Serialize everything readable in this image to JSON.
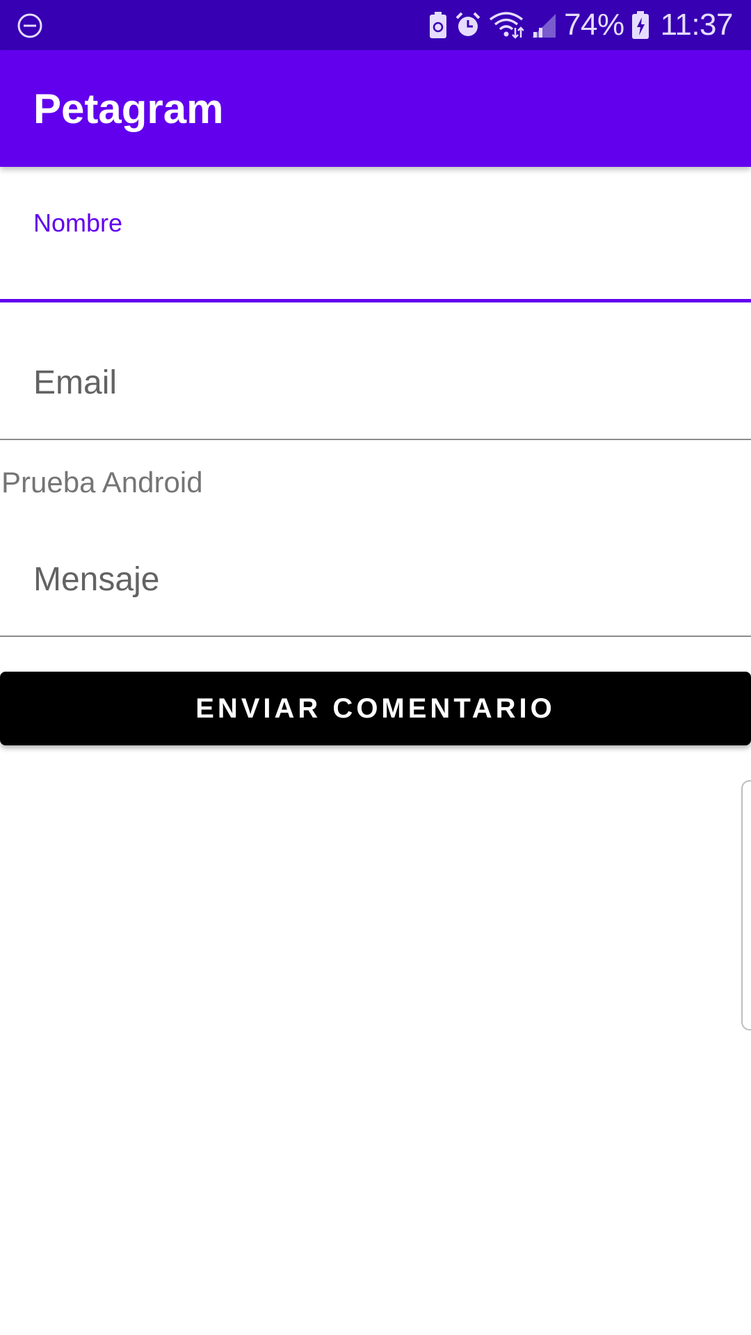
{
  "status_bar": {
    "left_icon": "do-not-disturb-icon",
    "icons": [
      "battery-saver-icon",
      "alarm-icon",
      "wifi-icon",
      "signal-icon"
    ],
    "battery_percent": "74%",
    "time": "11:37"
  },
  "app_bar": {
    "title": "Petagram"
  },
  "form": {
    "nombre": {
      "label": "Nombre",
      "value": ""
    },
    "email": {
      "placeholder": "Email",
      "value": ""
    },
    "prueba_text": "Prueba Android",
    "mensaje": {
      "placeholder": "Mensaje",
      "value": ""
    },
    "submit_label": "ENVIAR COMENTARIO"
  },
  "colors": {
    "status_bar": "#3700b3",
    "primary": "#6200ee",
    "button": "#000000"
  }
}
